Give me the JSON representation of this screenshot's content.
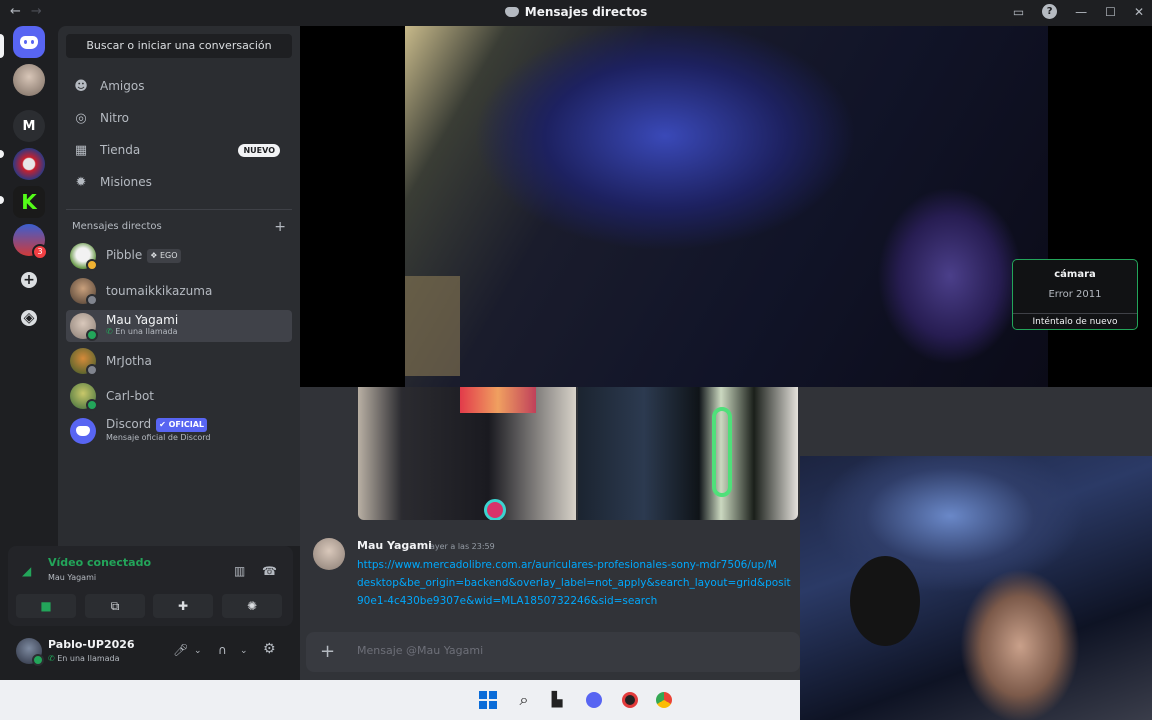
{
  "window": {
    "title": "Mensajes directos",
    "nav_back": "←",
    "nav_forward": "→",
    "controls": {
      "minimize": "—",
      "maximize": "☐",
      "close": "✕",
      "help": "?"
    }
  },
  "rail": {
    "server_letter": "M",
    "badge_count": "3"
  },
  "sidebar": {
    "search_label": "Buscar o iniciar una conversación",
    "nav": [
      {
        "label": "Amigos",
        "icon": "friends-icon"
      },
      {
        "label": "Nitro",
        "icon": "nitro-icon"
      },
      {
        "label": "Tienda",
        "icon": "shop-icon",
        "badge": "NUEVO"
      },
      {
        "label": "Misiones",
        "icon": "quests-icon"
      }
    ],
    "dm_header": "Mensajes directos",
    "dm_add": "+",
    "dms": [
      {
        "name": "Pibble",
        "tag": "EGO",
        "tag_prefix": "❖"
      },
      {
        "name": "toumaikkikazuma"
      },
      {
        "name": "Mau Yagami",
        "sub": "En una llamada"
      },
      {
        "name": "MrJotha"
      },
      {
        "name": "Carl-bot"
      },
      {
        "name": "Discord",
        "tag": "OFICIAL",
        "tag_prefix": "✔",
        "sub": "Mensaje oficial de Discord"
      }
    ]
  },
  "voice": {
    "status": "Vídeo conectado",
    "channel": "Mau Yagami"
  },
  "user": {
    "name": "Pablo-UP2026",
    "status": "En una llamada"
  },
  "call": {
    "camera_error_title": "cámara",
    "camera_error_code": "Error 2011",
    "camera_error_retry": "Inténtalo de nuevo"
  },
  "message": {
    "author": "Mau Yagami",
    "time": "ayer a las 23:59",
    "link_lines": [
      "https://www.mercadolibre.com.ar/auriculares-profesionales-sony-mdr7506/up/M",
      "desktop&be_origin=backend&overlay_label=not_apply&search_layout=grid&posit",
      "90e1-4c430be9307e&wid=MLA1850732246&sid=search"
    ]
  },
  "composer": {
    "placeholder": "Mensaje @Mau Yagami",
    "add": "+"
  },
  "colors": {
    "accent": "#5865f2",
    "online": "#23a55a",
    "link": "#00a8fc",
    "background": "#313338"
  }
}
